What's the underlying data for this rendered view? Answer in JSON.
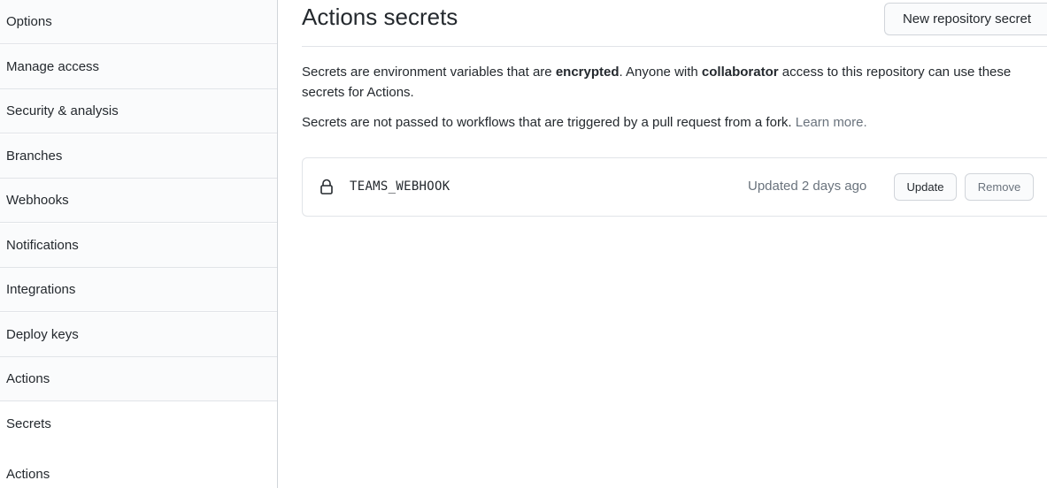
{
  "sidebar": {
    "items": [
      {
        "label": "Options"
      },
      {
        "label": "Manage access"
      },
      {
        "label": "Security & analysis"
      },
      {
        "label": "Branches"
      },
      {
        "label": "Webhooks"
      },
      {
        "label": "Notifications"
      },
      {
        "label": "Integrations"
      },
      {
        "label": "Deploy keys"
      },
      {
        "label": "Actions"
      },
      {
        "label": "Secrets",
        "selected": true
      }
    ],
    "sub_item": {
      "label": "Actions"
    }
  },
  "header": {
    "title": "Actions secrets",
    "new_secret_label": "New repository secret"
  },
  "description": {
    "part1": "Secrets are environment variables that are ",
    "bold1": "encrypted",
    "part2": ". Anyone with ",
    "bold2": "collaborator",
    "part3": " access to this repository can use these secrets for Actions.",
    "fork_note": "Secrets are not passed to workflows that are triggered by a pull request from a fork. ",
    "learn_more": "Learn more."
  },
  "secrets": [
    {
      "icon": "lock-icon",
      "name": "TEAMS_WEBHOOK",
      "updated": "Updated 2 days ago",
      "update_label": "Update",
      "remove_label": "Remove"
    }
  ]
}
